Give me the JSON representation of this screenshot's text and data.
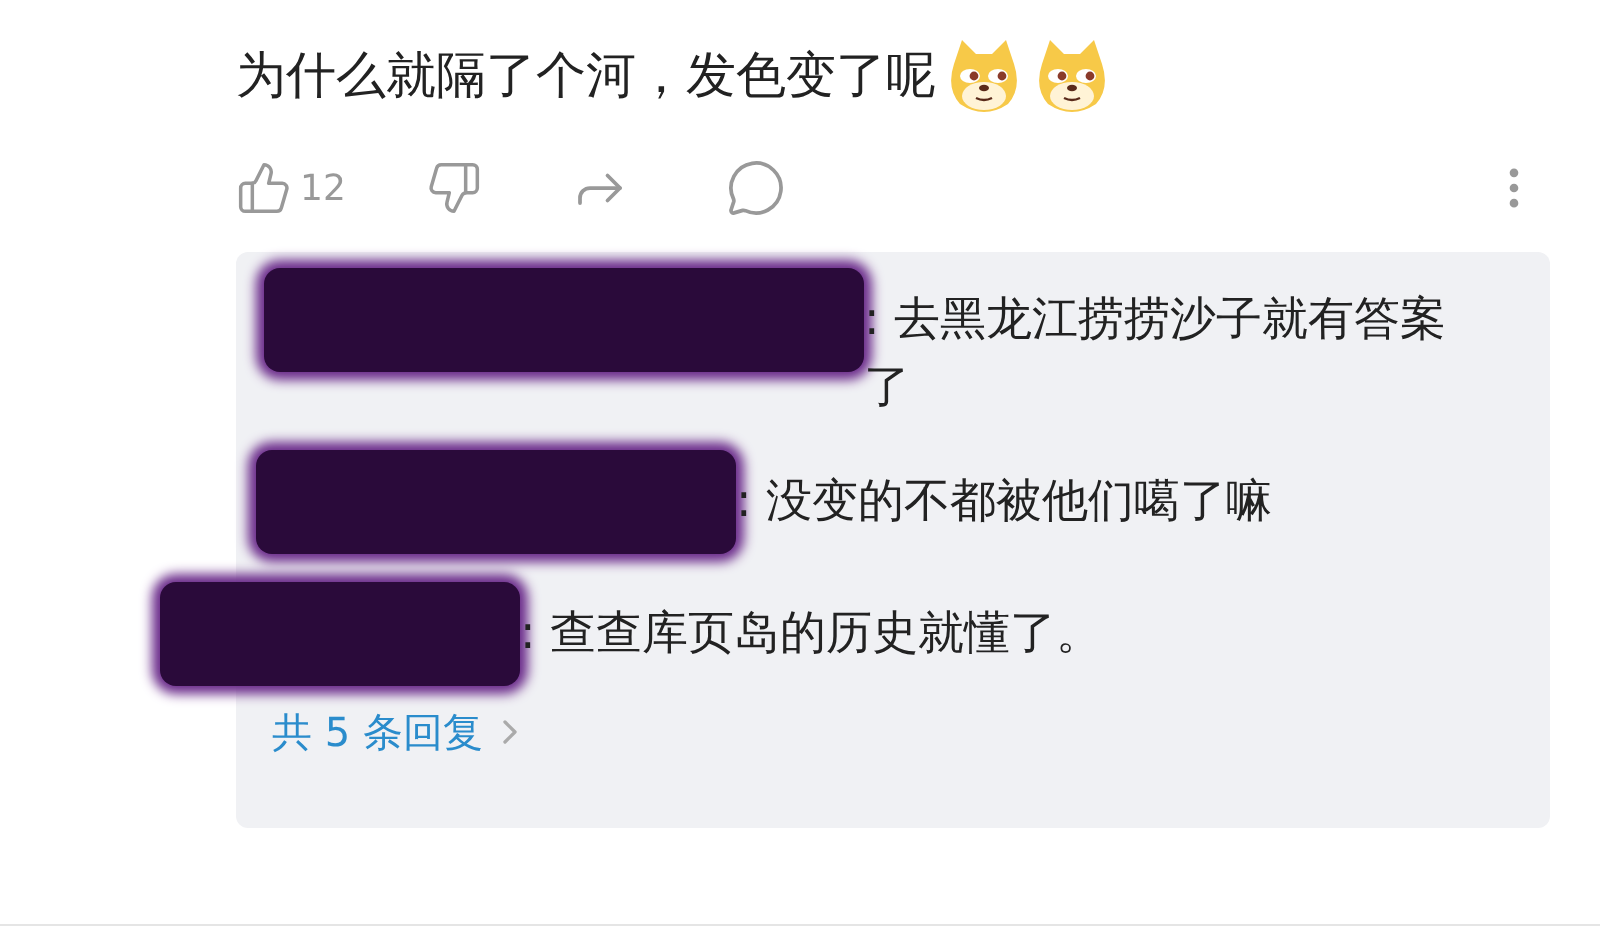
{
  "comment": {
    "text": "为什么就隔了个河，发色变了呢",
    "emojis": [
      {
        "kind": "dog"
      },
      {
        "kind": "dog"
      }
    ]
  },
  "actions": {
    "like_count": "12"
  },
  "replies": [
    {
      "text": ": 去黑龙江捞捞沙子就有答案了"
    },
    {
      "text": ": 没变的不都被他们噶了嘛"
    },
    {
      "text": ": 查查库页岛的历史就懂了。"
    }
  ],
  "more_replies": "共 5 条回复"
}
